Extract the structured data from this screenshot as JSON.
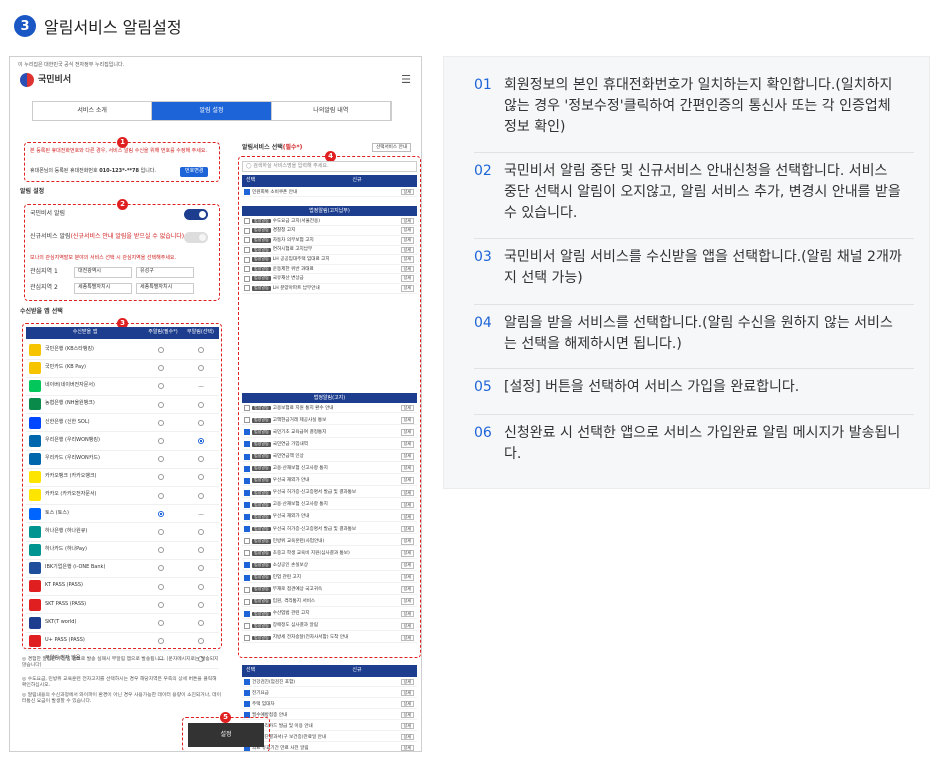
{
  "header": {
    "step": "3",
    "title": "알림서비스 알림설정"
  },
  "ss": {
    "note": "이 누리집은 대한민국 공식 전자정부 누리집입니다.",
    "app_name": "국민비서",
    "tabs": [
      "서비스 소개",
      "알림 설정",
      "나의알림 내역"
    ],
    "badges": [
      "1",
      "2",
      "3",
      "4",
      "5"
    ],
    "warn": "본 등록된 휴대전화번호와 다른 경우, 서비스 알림 수신을 위해 번호를 수정해 주세요.",
    "phone_label": "휴대폰님의 등록된 휴대전화번호",
    "phone": "010-123*-**78",
    "phone_suffix": "입니다.",
    "phone_btn": "번호변경",
    "alarm_setting": "알림 설정",
    "kb_alarm": "국민비서 알림",
    "new_alarm": "신규서비스 알림",
    "new_alarm_red": "(신규서비스 안내 알림을 받으실 수 없습니다)",
    "region_note": "보나의 관심지역발보 분야의 서비스 선택 시 관심지역을 선택해주세요.",
    "region1_label": "관심지역 1",
    "region1_a": "대전광역시",
    "region1_b": "유성구",
    "region2_label": "관심지역 2",
    "region2_a": "세종특별자치시",
    "region2_b": "세종특별자치시",
    "app_select_title": "수신받을 앱 선택",
    "app_cols": [
      "수신받을 앱",
      "주알림(필수*)",
      "부알림(선택)"
    ],
    "apps": [
      "국민은행 (KB스타뱅킹)",
      "국민카드 (KB Pay)",
      "네이버(네이버전자문서)",
      "농협은행 (NH올원뱅크)",
      "신한은행 (신한 SOL)",
      "우리은행 (우리WON뱅킹)",
      "우리카드 (우리WON카드)",
      "카카오뱅크 (카카오뱅크)",
      "카카오 (카카오전자문서)",
      "토스 (토스)",
      "하나은행 (하나원큐)",
      "하나카드 (하나Pay)",
      "IBK기업은행 (i-ONE Bank)",
      "KT PASS (PASS)",
      "SKT PASS (PASS)",
      "SKT(T world)",
      "U+ PASS (PASS)",
      "부알림 받지 않음"
    ],
    "svc_select_title": "알림서비스 선택",
    "svc_select_req": "(필수*)",
    "svc_guide": "선택서비스 안내",
    "svc_search": "검색하실 서비스명을 입력해 주세요.",
    "svc_cols": [
      "선택",
      "신규"
    ],
    "svc_new": "민원회복 소비쿠폰 안내",
    "sub1": "법정알림(고지납부)",
    "sub2": "법정알림(고지)",
    "sub3": "건강/주거/복지",
    "tag": "법정알림",
    "svc_a": [
      "수도요금 고지(서울전용)",
      "경찰청 고지",
      "자동차 의무보험 고지",
      "면허시험료 고지납부",
      "LH 공공임대주택 임대료 고지",
      "운동제한 위반 과태료",
      "국유재산 변상금",
      "LH 분양아파트 납부안내"
    ],
    "svc_b": [
      "고용보험료 지원 통지 환수 안내",
      "고액현금거래 제공사실 통보",
      "국민기초 교육급여 결정통지",
      "국민연금 가입내역",
      "국민연금액 인상",
      "고용·산재보험 신고사항 통지",
      "우선국 재외가 안내",
      "우선국 허가증·신고증명서 발급 및 결과통보",
      "고용·산재보험 신고사항 통지",
      "우선국 재외가 안내",
      "우선국 허가증·신고증명서 발급 및 결과통보",
      "민방위 교육훈련(사업안내)",
      "초중고 학생 교육비 지원(심사결과 통보)",
      "소상공인 손실보상",
      "민업 관련 고지",
      "부재로 접견예상 국고귀속",
      "입원, 격리통지 서비스",
      "수산업법 관련 고지",
      "장애정도 심사결과 알림",
      "지방세 전자송달(전자사서함) 도착 안내"
    ],
    "svc_c": [
      "건강검진(암검진 포함)",
      "전기요금",
      "주택 임대차",
      "필수예방접종 안내",
      "문화누리카드 발급 및 이용 안내",
      "건강진단결과서(구 보건증)만료일 안내",
      "의료 유효기간 만료 사전 알림"
    ],
    "detail": "상세",
    "footnotes": [
      "◎ 경험한 알림은 주알림 앱으로 발송 실패시 부알림 앱으로 발송됩니다. (문자메시지로는 발송되지 않습니다)",
      "◎ 수도요금, 민방위 교육훈련 전자고지를 선택하시는 경우 해당지역은 우측의 상세 버튼을 클릭해 확인하십시오.",
      "◎ 알림내용의 수신과정에서 와이파이 환경이 아닌 경우 사용가능한 데이터 용량이 소진되거나, 데이터통신 요금이 발생할 수 있습니다."
    ],
    "set_btn": "설정"
  },
  "steps": [
    {
      "n": "01",
      "text": "회원정보의 본인 휴대전화번호가 일치하는지 확인합니다.(일치하지 않는 경우 '정보수정'클릭하여 간편인증의 통신사 또는 각 인증업체 정보 확인)"
    },
    {
      "n": "02",
      "text": "국민비서 알림 중단 및 신규서비스 안내신청을 선택합니다. 서비스 중단 선택시 알림이 오지않고, 알림 서비스 추가, 변경시 안내를 받을 수 있습니다."
    },
    {
      "n": "03",
      "text": "국민비서 알림 서비스를 수신받을 앱을 선택합니다.(알림 채널 2개까지 선택 가능)"
    },
    {
      "n": "04",
      "text": "알림을 받을 서비스를 선택합니다.(알림 수신을 원하지 않는 서비스는 선택을 해제하시면 됩니다.)"
    },
    {
      "n": "05",
      "text": "[설정] 버튼을 선택하여 서비스 가입을 완료합니다."
    },
    {
      "n": "06",
      "text": "신청완료 시 선택한 앱으로 서비스 가입완료 알림 메시지가 발송됩니다."
    }
  ],
  "colors": {
    "brand": "#1d64d8",
    "navy": "#1d3e8f",
    "accent": "#e02020"
  }
}
